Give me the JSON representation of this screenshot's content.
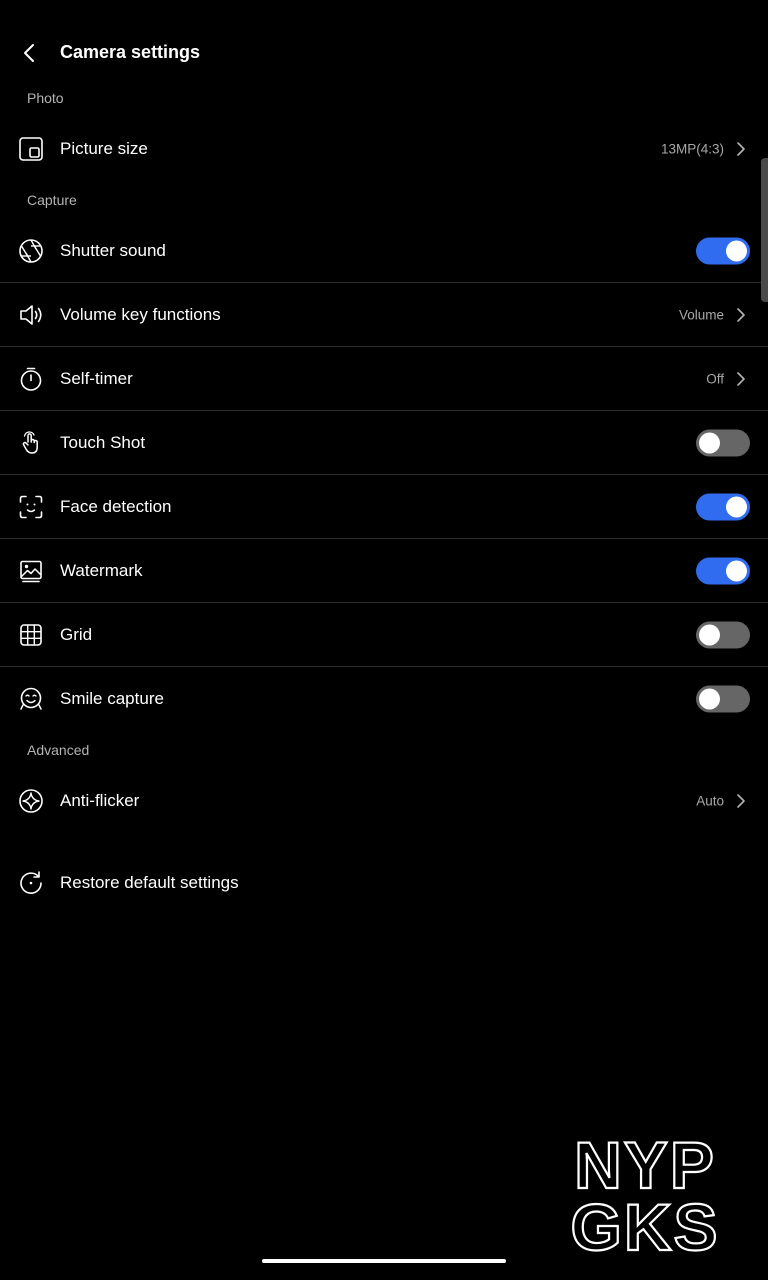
{
  "header": {
    "title": "Camera settings"
  },
  "sections": {
    "photo": "Photo",
    "capture": "Capture",
    "advanced": "Advanced"
  },
  "rows": {
    "picture_size": {
      "label": "Picture size",
      "value": "13MP(4:3)"
    },
    "shutter_sound": {
      "label": "Shutter sound",
      "enabled": true
    },
    "volume_key": {
      "label": "Volume key functions",
      "value": "Volume"
    },
    "self_timer": {
      "label": "Self-timer",
      "value": "Off"
    },
    "touch_shot": {
      "label": "Touch Shot",
      "enabled": false
    },
    "face_detection": {
      "label": "Face detection",
      "enabled": true
    },
    "watermark": {
      "label": "Watermark",
      "enabled": true
    },
    "grid": {
      "label": "Grid",
      "enabled": false
    },
    "smile_capture": {
      "label": "Smile capture",
      "enabled": false
    },
    "anti_flicker": {
      "label": "Anti-flicker",
      "value": "Auto"
    },
    "restore": {
      "label": "Restore default settings"
    }
  },
  "watermark_logo": {
    "line1": "NYP",
    "line2": "GKS"
  },
  "colors": {
    "background": "#000000",
    "toggle_on": "#2f6cf0",
    "toggle_off": "#666666",
    "value_text": "#a8a8a8"
  },
  "icons": [
    "back-arrow-icon",
    "picture-size-icon",
    "shutter-aperture-icon",
    "speaker-icon",
    "timer-icon",
    "touch-hand-icon",
    "face-detect-icon",
    "watermark-image-icon",
    "grid-icon",
    "smile-face-icon",
    "anti-flicker-icon",
    "restore-icon",
    "chevron-right-icon"
  ]
}
